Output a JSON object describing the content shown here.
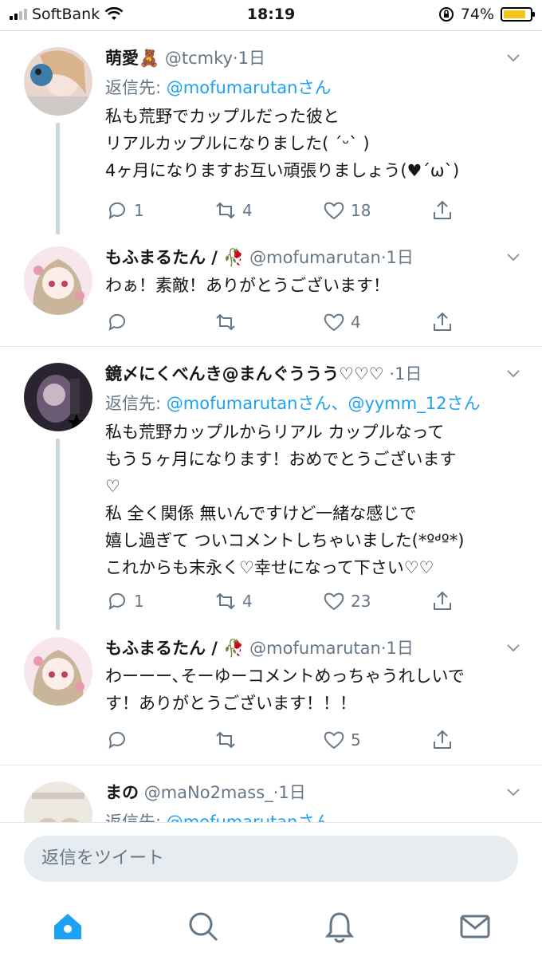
{
  "status_bar": {
    "carrier": "SoftBank",
    "time": "18:19",
    "battery": "74%"
  },
  "tweets": [
    {
      "name": "萌愛🧸",
      "handle": "@tcmky",
      "time": "1日",
      "reply_prefix": "返信先: ",
      "reply_to": "@mofumarutanさん",
      "text": "私も荒野でカップルだった彼と\nリアルカップルになりました( ´ᵕ` )\n4ヶ月になりますお互い頑張りましょう(♥︎´ω`)",
      "replies": "1",
      "retweets": "4",
      "likes": "18"
    },
    {
      "name": "もふまるたん / 🥀",
      "handle": "@mofumarutan",
      "time": "1日",
      "text": "わぁ！素敵！ありがとうございます！",
      "replies": "",
      "retweets": "",
      "likes": "4"
    },
    {
      "name": "鏡〆にくべんき@まんぐううう♡♡♡",
      "handle": "",
      "time": "1日",
      "reply_prefix": "返信先: ",
      "reply_to": "@mofumarutanさん、@yymm_12さん",
      "text": "私も荒野カップルからリアル カップルなって\nもう５ヶ月になります！おめでとうございます\n♡\n私 全く関係 無いんですけど一緒な感じで\n嬉し過ぎて ついコメントしちゃいました(*ºᒄº*)\nこれからも末永く♡幸せになって下さい♡♡",
      "replies": "1",
      "retweets": "4",
      "likes": "23"
    },
    {
      "name": "もふまるたん / 🥀",
      "handle": "@mofumarutan",
      "time": "1日",
      "text": "わーーー､そーゆーコメントめっちゃうれしいで\nす！ありがとうございます！！！",
      "replies": "",
      "retweets": "",
      "likes": "5"
    },
    {
      "name": "まの",
      "handle": "@maNo2mass_",
      "time": "1日",
      "reply_prefix": "返信先: ",
      "reply_to": "@mofumarutanさん"
    }
  ],
  "reply_box": {
    "placeholder": "返信をツイート"
  },
  "tabs": [
    "home-icon",
    "search-icon",
    "bell-icon",
    "mail-icon"
  ],
  "colors": {
    "link": "#1da1f2",
    "muted": "#657786",
    "active_tab": "#1da1f2"
  }
}
